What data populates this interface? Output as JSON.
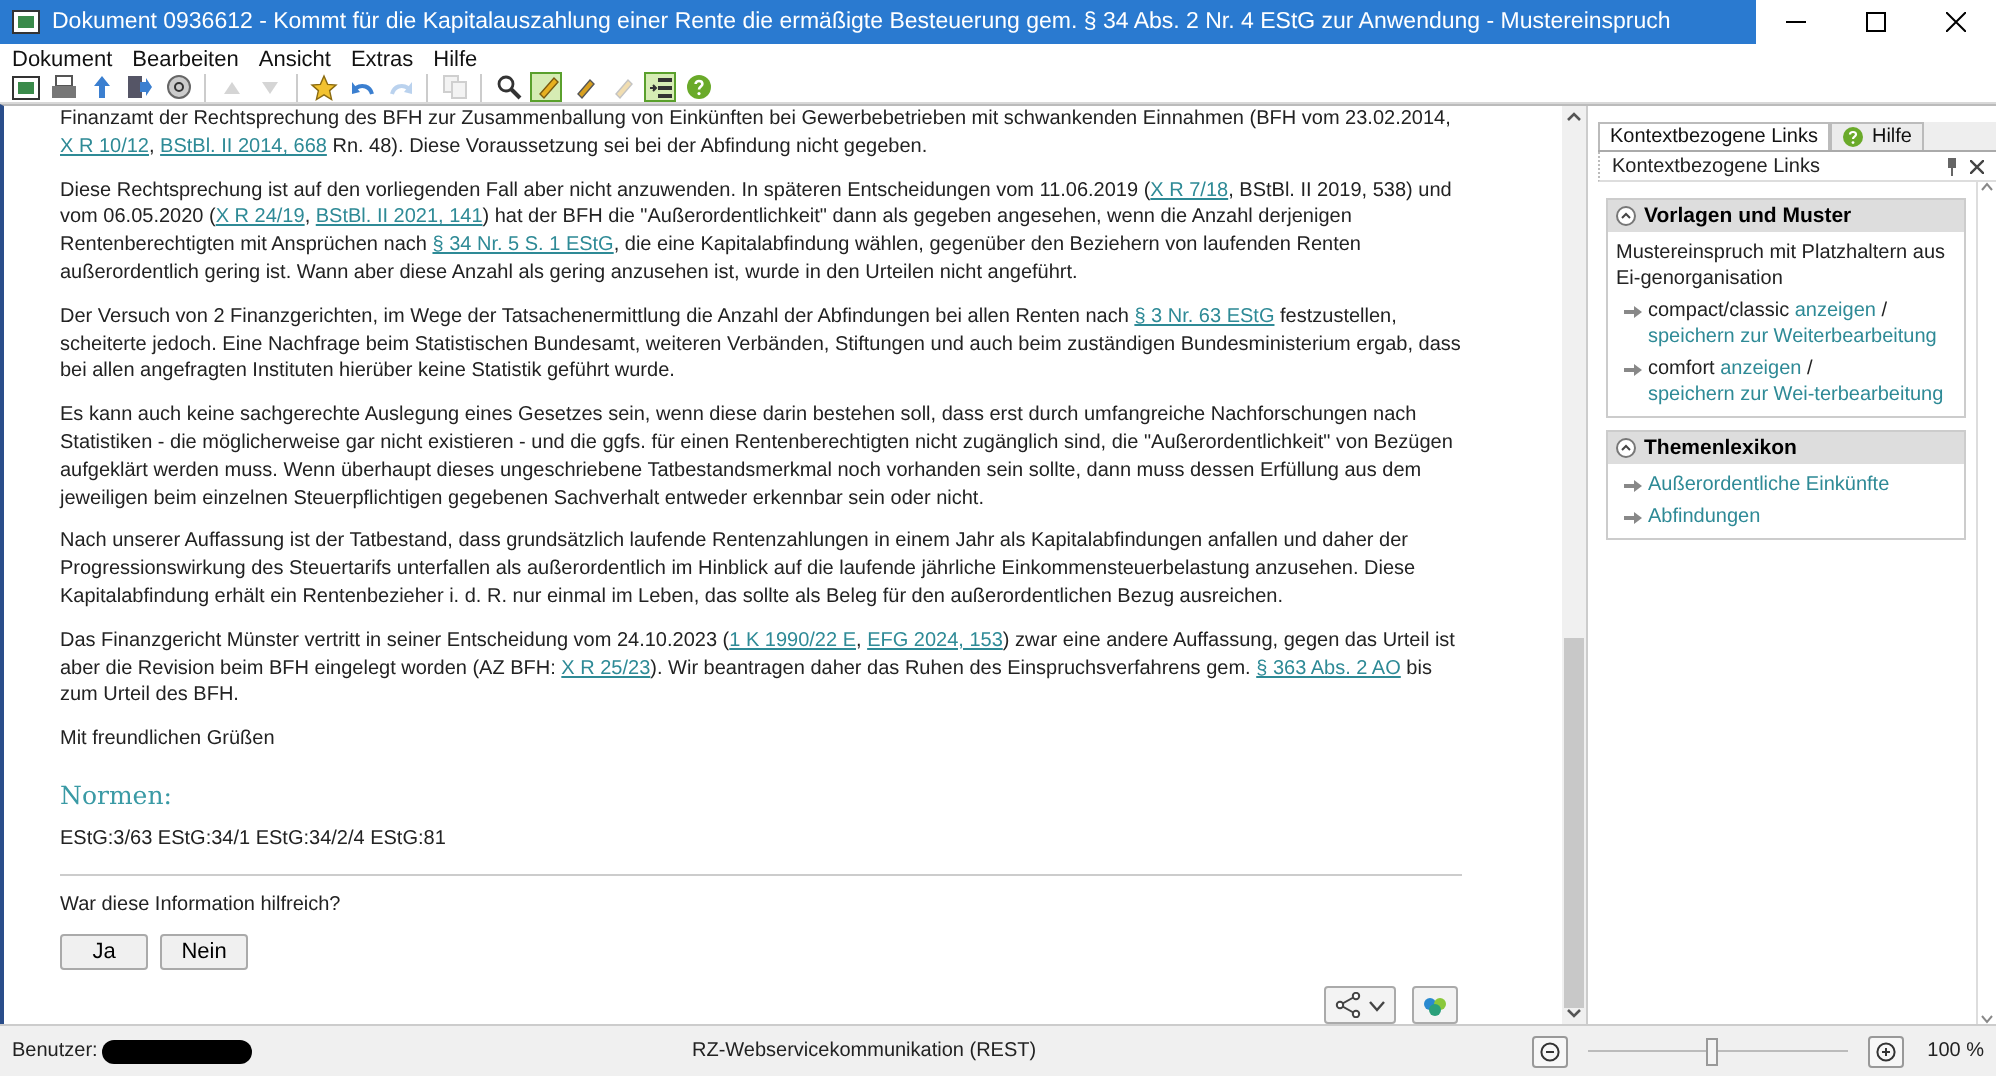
{
  "window": {
    "title": "Dokument 0936612 - Kommt für die Kapitalauszahlung einer Rente die ermäßigte Besteuerung gem. § 34 Abs. 2 Nr. 4 EStG zur Anwendung - Mustereinspruch"
  },
  "menu": [
    {
      "label": "Dokument"
    },
    {
      "label": "Bearbeiten"
    },
    {
      "label": "Ansicht"
    },
    {
      "label": "Extras"
    },
    {
      "label": "Hilfe"
    }
  ],
  "toolbar": [
    {
      "kind": "logo",
      "selected": false,
      "disabled": false
    },
    {
      "kind": "print",
      "selected": false,
      "disabled": false
    },
    {
      "kind": "up",
      "selected": false,
      "disabled": false
    },
    {
      "kind": "export",
      "selected": false,
      "disabled": false
    },
    {
      "kind": "at",
      "selected": false,
      "disabled": false
    },
    {
      "kind": "sep"
    },
    {
      "kind": "prev",
      "selected": false,
      "disabled": true
    },
    {
      "kind": "next",
      "selected": false,
      "disabled": true
    },
    {
      "kind": "sep"
    },
    {
      "kind": "star",
      "selected": false,
      "disabled": false
    },
    {
      "kind": "undo",
      "selected": false,
      "disabled": false
    },
    {
      "kind": "redo",
      "selected": false,
      "disabled": true
    },
    {
      "kind": "sep"
    },
    {
      "kind": "copy",
      "selected": false,
      "disabled": true
    },
    {
      "kind": "sep"
    },
    {
      "kind": "search",
      "selected": false,
      "disabled": false
    },
    {
      "kind": "pen",
      "selected": true,
      "disabled": false
    },
    {
      "kind": "marker",
      "selected": false,
      "disabled": false
    },
    {
      "kind": "marker",
      "selected": false,
      "disabled": true
    },
    {
      "kind": "list",
      "selected": true,
      "disabled": false
    },
    {
      "kind": "help",
      "selected": false,
      "disabled": false
    }
  ],
  "document": {
    "paragraphs": [
      [
        {
          "kind": "text",
          "text": "Finanzamt der Rechtsprechung des BFH zur Zusammenballung von Einkünften bei Gewerbebetrieben mit schwankenden Einnahmen (BFH vom 23.02.2014, "
        },
        {
          "kind": "link",
          "text": "X R 10/12"
        },
        {
          "kind": "text",
          "text": ", "
        },
        {
          "kind": "link",
          "text": "BStBl. II 2014, 668"
        },
        {
          "kind": "text",
          "text": " Rn. 48). Diese Voraussetzung sei bei der Abfindung nicht gegeben."
        }
      ],
      [
        {
          "kind": "text",
          "text": "Diese Rechtsprechung ist auf den vorliegenden Fall aber nicht anzuwenden. In späteren Entscheidungen vom 11.06.2019 ("
        },
        {
          "kind": "link",
          "text": "X R 7/18"
        },
        {
          "kind": "text",
          "text": ", BStBl. II 2019, 538) und vom 06.05.2020 ("
        },
        {
          "kind": "link",
          "text": "X R 24/19"
        },
        {
          "kind": "text",
          "text": ", "
        },
        {
          "kind": "link",
          "text": "BStBl. II 2021, 141"
        },
        {
          "kind": "text",
          "text": ") hat der BFH die \"Außerordentlichkeit\" dann als gegeben angesehen, wenn die Anzahl derjenigen Rentenberechtigten mit Ansprüchen nach "
        },
        {
          "kind": "link",
          "text": "§ 34 Nr. 5 S. 1 EStG"
        },
        {
          "kind": "text",
          "text": ", die eine Kapitalabfindung wählen, gegenüber den Beziehern von laufenden Renten außerordentlich gering ist. Wann aber diese Anzahl als gering anzusehen ist, wurde in den Urteilen nicht angeführt."
        }
      ],
      [
        {
          "kind": "text",
          "text": "Der Versuch von 2 Finanzgerichten, im Wege der Tatsachenermittlung die Anzahl der Abfindungen bei allen Renten nach "
        },
        {
          "kind": "link",
          "text": "§ 3 Nr. 63 EStG"
        },
        {
          "kind": "text",
          "text": " festzustellen, scheiterte jedoch. Eine Nachfrage beim Statistischen Bundesamt, weiteren Verbänden, Stiftungen und auch beim zuständigen Bundesministerium ergab, dass bei allen angefragten Instituten hierüber keine Statistik geführt wurde."
        }
      ],
      [
        {
          "kind": "text",
          "text": "Es kann auch keine sachgerechte Auslegung eines Gesetzes sein, wenn diese darin bestehen soll, dass erst durch umfangreiche Nachforschungen nach Statistiken - die möglicherweise gar nicht existieren - und die ggfs. für einen Rentenberechtigten nicht zugänglich sind, die \"Außerordentlichkeit\" von Bezügen aufgeklärt werden muss. Wenn überhaupt dieses ungeschriebene Tatbestandsmerkmal noch vorhanden sein sollte, dann muss dessen Erfüllung aus dem jeweiligen beim einzelnen Steuerpflichtigen gegebenen Sachverhalt entweder erkennbar sein oder nicht."
        }
      ],
      [
        {
          "kind": "text",
          "text": "Nach unserer Auffassung ist der Tatbestand, dass grundsätzlich laufende Rentenzahlungen in einem Jahr als Kapitalabfindungen anfallen und daher der Progressionswirkung des Steuertarifs unterfallen als außerordentlich im Hinblick auf die laufende jährliche Einkommensteuerbelastung anzusehen. Diese Kapitalabfindung erhält ein Rentenbezieher i. d. R. nur einmal im Leben, das sollte als Beleg für den außerordentlichen Bezug ausreichen."
        }
      ],
      [
        {
          "kind": "text",
          "text": "Das Finanzgericht Münster vertritt in seiner Entscheidung vom 24.10.2023 ("
        },
        {
          "kind": "link",
          "text": "1 K 1990/22 E"
        },
        {
          "kind": "text",
          "text": ", "
        },
        {
          "kind": "link",
          "text": "EFG 2024, 153"
        },
        {
          "kind": "text",
          "text": ") zwar eine andere Auffassung, gegen das Urteil ist aber die Revision beim BFH eingelegt worden (AZ BFH: "
        },
        {
          "kind": "link",
          "text": "X R 25/23"
        },
        {
          "kind": "text",
          "text": "). Wir beantragen daher das Ruhen des Einspruchsverfahrens gem. "
        },
        {
          "kind": "link",
          "text": "§ 363 Abs. 2 AO"
        },
        {
          "kind": "text",
          "text": " bis zum Urteil des BFH."
        }
      ],
      [
        {
          "kind": "text",
          "text": "Mit freundlichen Grüßen"
        }
      ]
    ],
    "norms_heading": "Normen:",
    "norms": "EStG:3/63 EStG:34/1 EStG:34/2/4 EStG:81",
    "feedback": {
      "question": "War diese Information hilfreich?",
      "buttons": [
        "Ja",
        "Nein"
      ]
    }
  },
  "side_panel": {
    "tabs": [
      {
        "label": "Kontextbezogene Links",
        "selected": true,
        "icon": false
      },
      {
        "label": "Hilfe",
        "selected": false,
        "icon": true
      }
    ],
    "header": "Kontextbezogene Links",
    "sections": [
      {
        "title": "Vorlagen und Muster",
        "expanded": true,
        "intro": "Mustereinspruch mit Platzhaltern aus Ei-genorganisation",
        "items": [
          [
            {
              "kind": "text",
              "text": "compact/classic "
            },
            {
              "kind": "link",
              "text": "anzeigen"
            },
            {
              "kind": "text",
              "text": " / "
            },
            {
              "kind": "link",
              "text": "speichern zur Weiterbearbeitung"
            }
          ],
          [
            {
              "kind": "text",
              "text": "comfort "
            },
            {
              "kind": "link",
              "text": "anzeigen"
            },
            {
              "kind": "text",
              "text": " / "
            },
            {
              "kind": "link",
              "text": "speichern zur Wei-terbearbeitung"
            }
          ]
        ]
      },
      {
        "title": "Themenlexikon",
        "expanded": true,
        "items": [
          [
            {
              "kind": "link",
              "text": "Außerordentliche Einkünfte"
            }
          ],
          [
            {
              "kind": "link",
              "text": "Abfindungen"
            }
          ]
        ]
      }
    ]
  },
  "status_bar": {
    "user_label": "Benutzer:",
    "service": "RZ-Webservicekommunikation (REST)",
    "zoom": {
      "level": 0.48
    },
    "zoom_text": "100 %"
  }
}
